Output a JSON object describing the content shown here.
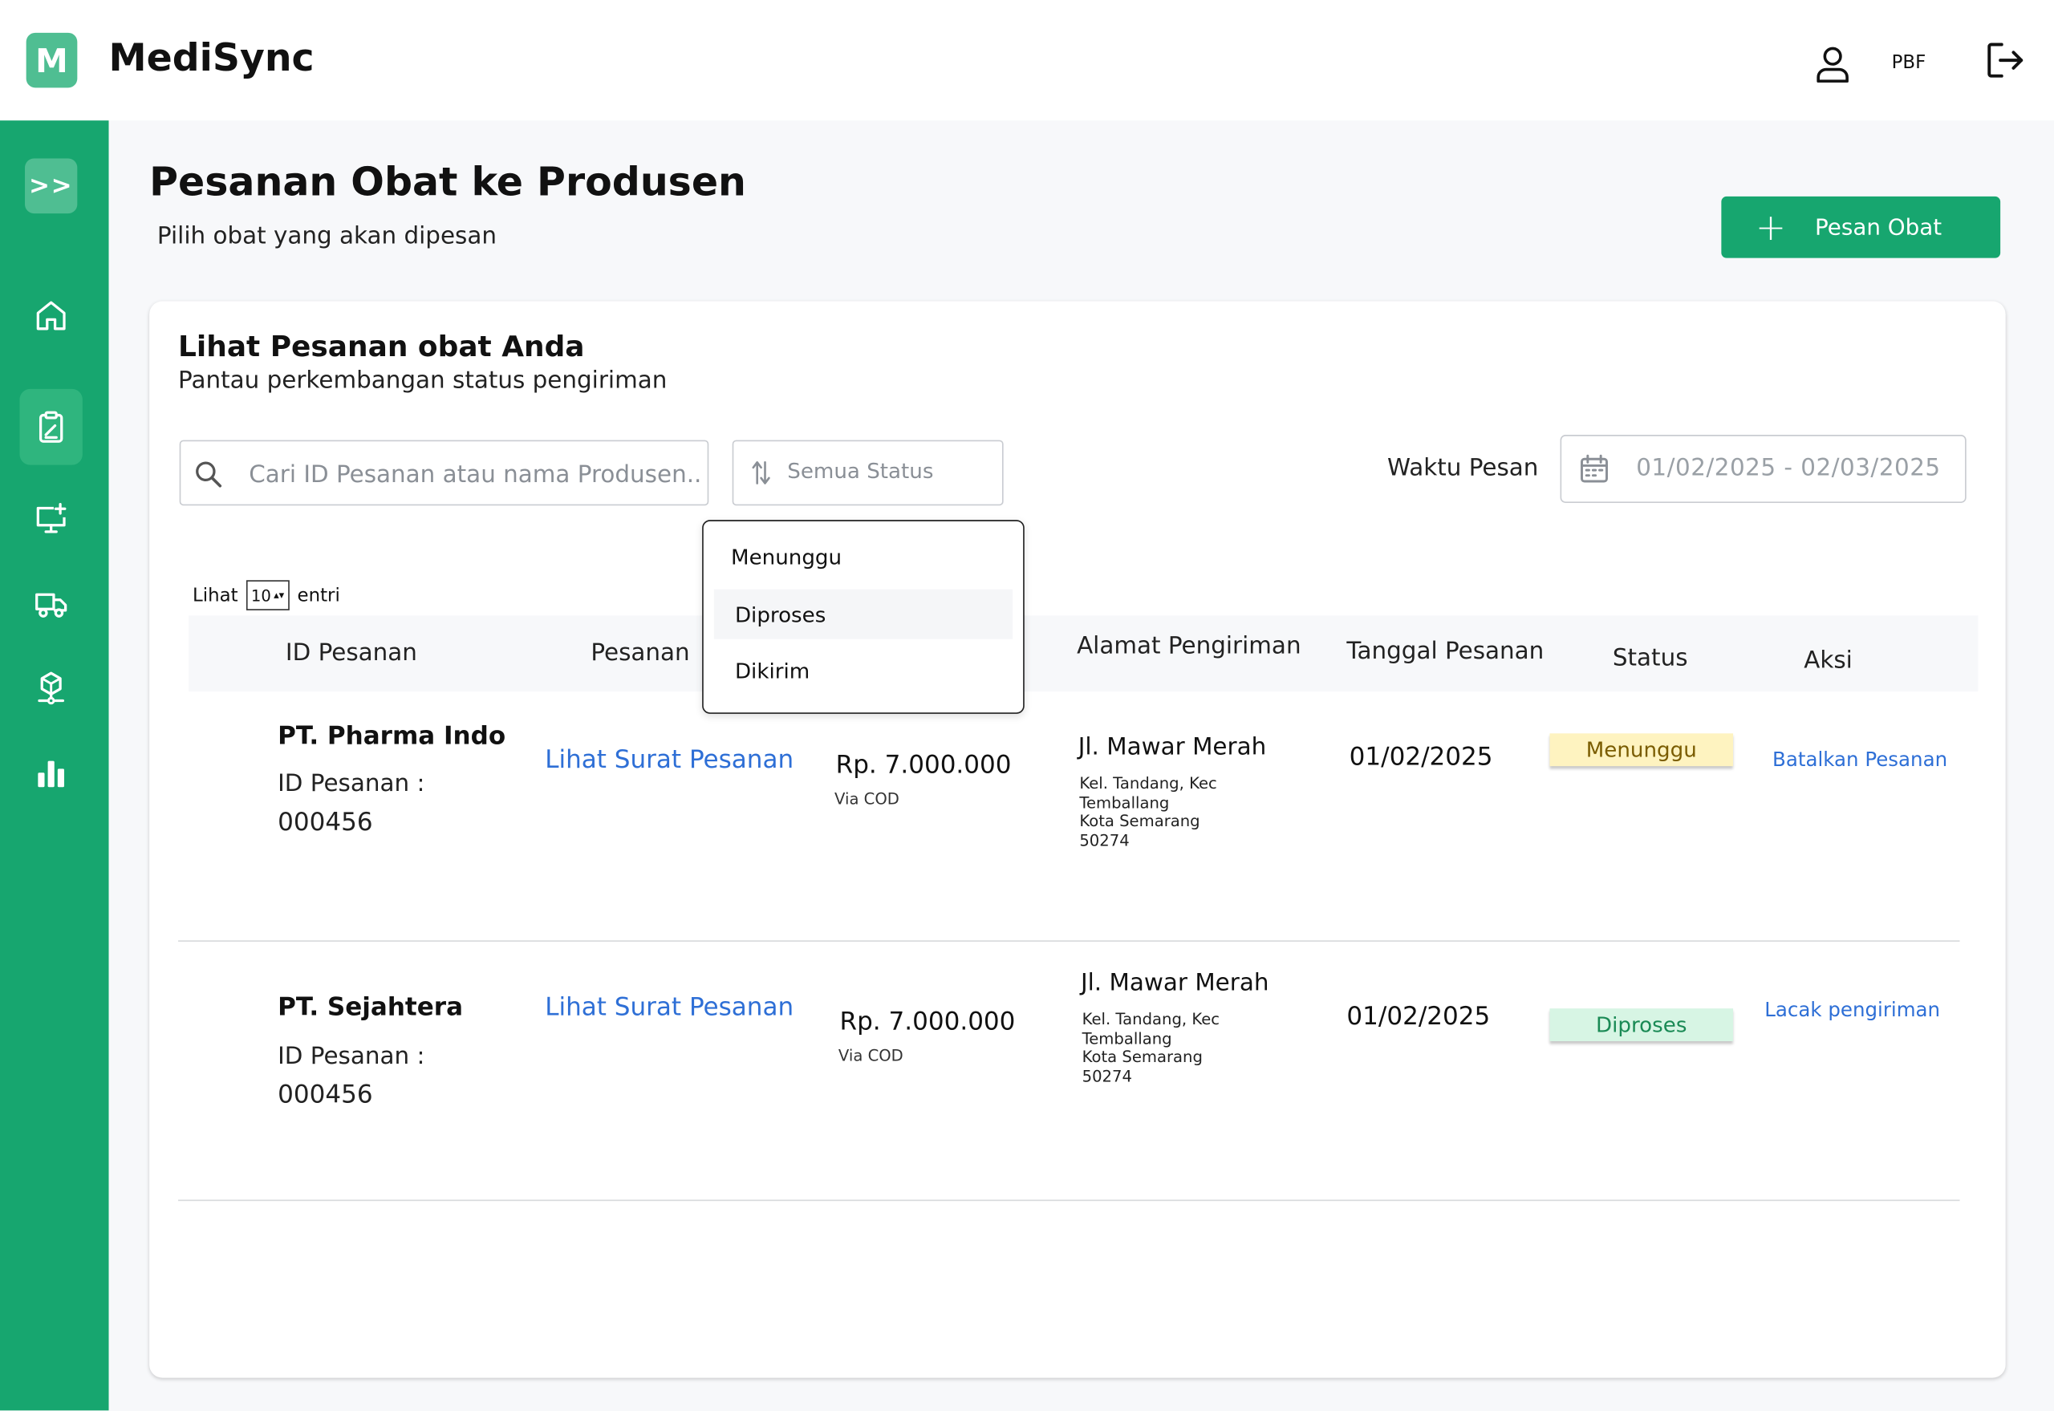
{
  "header": {
    "logo_letter": "M",
    "app_name": "MediSync",
    "role": "PBF",
    "icons": [
      "user-icon",
      "logout-icon"
    ]
  },
  "sidebar": {
    "toggle_label": ">>",
    "items": [
      {
        "name": "home",
        "icon": "home-icon",
        "active": false
      },
      {
        "name": "orders",
        "icon": "clipboard-icon",
        "active": true
      },
      {
        "name": "monitor-add",
        "icon": "monitor-plus-icon",
        "active": false
      },
      {
        "name": "delivery",
        "icon": "truck-icon",
        "active": false
      },
      {
        "name": "products",
        "icon": "box-network-icon",
        "active": false
      },
      {
        "name": "reports",
        "icon": "bar-chart-icon",
        "active": false
      }
    ]
  },
  "page": {
    "title": "Pesanan Obat ke Produsen",
    "subtitle": "Pilih obat yang akan dipesan",
    "primary_button": "Pesan Obat"
  },
  "card": {
    "title": "Lihat Pesanan obat Anda",
    "subtitle": "Pantau perkembangan status pengiriman",
    "search_placeholder": "Cari ID Pesanan atau nama Produsen...",
    "status_filter": "Semua Status",
    "date_label": "Waktu Pesan",
    "date_range": "01/02/2025 - 02/03/2025",
    "entries": {
      "prefix": "Lihat",
      "value": "10",
      "suffix": "entri"
    }
  },
  "dropdown": {
    "options": [
      "Menunggu",
      "Diproses",
      "Dikirim"
    ],
    "highlighted": "Diproses"
  },
  "table": {
    "headers": [
      "ID Pesanan",
      "Pesanan",
      "Alamat Pengiriman",
      "Tanggal Pesanan",
      "Status",
      "Aksi"
    ],
    "rows": [
      {
        "company": "PT. Pharma Indo",
        "id_label": "ID Pesanan :",
        "id": "000456",
        "order_link": "Lihat Surat Pesanan",
        "price": "Rp. 7.000.000",
        "payment": "Via  COD",
        "street": "Jl. Mawar Merah",
        "address": [
          "Kel. Tandang, Kec",
          "Temballang",
          "Kota Semarang",
          "50274"
        ],
        "date": "01/02/2025",
        "status": "Menunggu",
        "status_color": "#fef3c0",
        "action": "Batalkan Pesanan"
      },
      {
        "company": "PT. Sejahtera",
        "id_label": "ID Pesanan :",
        "id": "000456",
        "order_link": "Lihat Surat Pesanan",
        "price": "Rp. 7.000.000",
        "payment": "Via  COD",
        "street": "Jl. Mawar Merah",
        "address": [
          "Kel. Tandang, Kec",
          "Temballang",
          "Kota Semarang",
          "50274"
        ],
        "date": "01/02/2025",
        "status": "Diproses",
        "status_color": "#d7f5e4",
        "action": "Lacak pengiriman"
      }
    ]
  },
  "colors": {
    "primary": "#17a66f",
    "logo": "#4fbe92",
    "link": "#2e6fd6"
  }
}
